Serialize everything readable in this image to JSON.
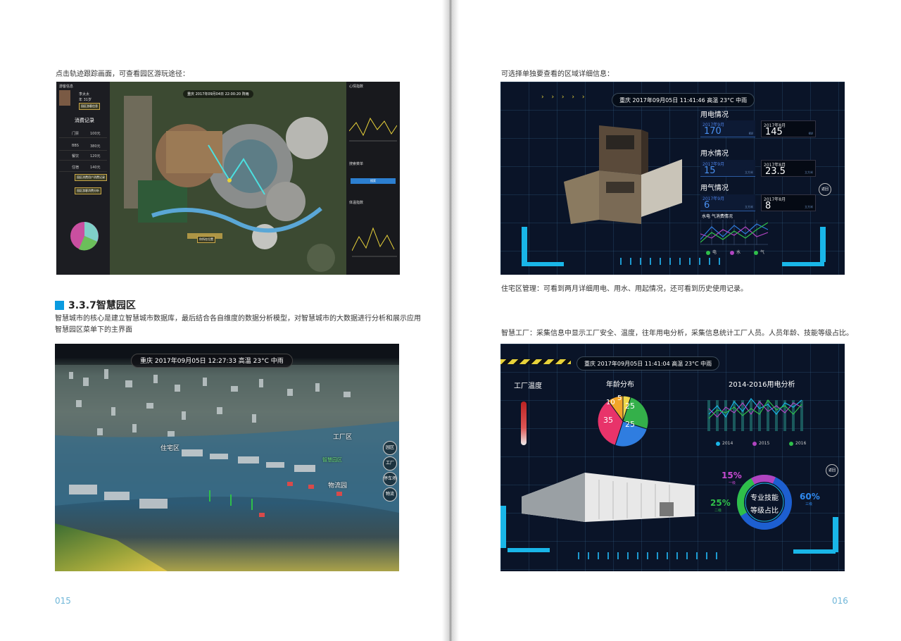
{
  "left_page": {
    "caption_top": "点击轨迹跟踪画面，可查看园区游玩途径：",
    "section": {
      "number_title": "3.3.7智慧园区"
    },
    "body_lines": [
      "智慧城市的核心是建立智慧城市数据库，最后结合各自维度的数据分析模型，对智慧城市的大数据进行分析和展示应用",
      "智慧园区菜单下的主界面"
    ],
    "page_number": "015",
    "tracking_screen": {
      "header_left": "游客信息",
      "visitor_name": "李太太",
      "visitor_age": "年 31岁",
      "tag1": "园区游客信息",
      "consume_title": "消费记录",
      "consume_rows": [
        {
          "label": "门票",
          "value": "100元"
        },
        {
          "label": "BBS",
          "value": "380元"
        },
        {
          "label": "餐饮",
          "value": "120元"
        },
        {
          "label": "住宿",
          "value": "140元"
        }
      ],
      "tag2": "园区消费用户消费记录",
      "tag3": "园区游客消费分析",
      "top_bar": "重庆  2017年09月04日 22:00:20  阵雨",
      "map_marker": "你所在位置",
      "right_panel_title": "心情指数",
      "right_panel_mid": "搜索菜单",
      "right_panel_btn": "搜索",
      "right_panel_bottom": "体温指数"
    },
    "city_screen": {
      "info_bar": "重庆   2017年09月05日 12:27:33   高温 23°C   中雨",
      "labels": {
        "residential": "住宅区",
        "factory": "工厂区",
        "logistics": "物流园",
        "marker": "智慧园区"
      },
      "side_buttons": [
        "园区",
        "工厂",
        "停车场",
        "物流"
      ]
    }
  },
  "right_page": {
    "caption_top": "可选择单独要查看的区域详细信息：",
    "caption_mid": "住宅区管理：可看到两月详细用电、用水、用起情况，还可看到历史使用记录。",
    "caption_factory": "智慧工厂：采集信息中显示工厂安全、温度，往年用电分析，采集信息统计工厂人员。人员年龄、技能等级占比。",
    "page_number": "016",
    "residential_screen": {
      "info_bar": "重庆  2017年09月05日 11:41:46  高温 23°C  中雨",
      "sections": [
        {
          "title": "用电情况",
          "left": {
            "month": "2017年9月",
            "value": "170",
            "unit": "KW"
          },
          "right": {
            "month": "2017年8月",
            "value": "145",
            "unit": "KW"
          }
        },
        {
          "title": "用水情况",
          "left": {
            "month": "2017年9月",
            "value": "15",
            "unit": "立方米"
          },
          "right": {
            "month": "2017年8月",
            "value": "23.5",
            "unit": "立方米"
          }
        },
        {
          "title": "用气情况",
          "left": {
            "month": "2017年9月",
            "value": "6",
            "unit": "立方米"
          },
          "right": {
            "month": "2017年8月",
            "value": "8",
            "unit": "立方米"
          }
        }
      ],
      "chart_title": "水电 气消费情况",
      "legend": [
        "电",
        "水",
        "气"
      ],
      "back_button": "返回",
      "colors": {
        "accent": "#19b6e8",
        "electric": "#2f7de0",
        "water": "#b044c0",
        "gas": "#2fbf4a"
      }
    },
    "factory_screen": {
      "info_bar": "重庆  2017年09月05日 11:41:04  高温 23°C  中雨",
      "temp_title": "工厂温度",
      "age_title": "年龄分布",
      "power_title": "2014-2016用电分析",
      "age_pie": [
        {
          "value": "10",
          "color": "#f2a52a"
        },
        {
          "value": "5",
          "color": "#f0d84a"
        },
        {
          "value": "25",
          "color": "#34b04a"
        },
        {
          "value": "25",
          "color": "#2f7de0"
        },
        {
          "value": "35",
          "color": "#e8336a"
        }
      ],
      "legend": [
        "2014",
        "2015",
        "2016"
      ],
      "skill": {
        "center_line1": "专业技能",
        "center_line2": "等级占比",
        "p1": "15%",
        "p1_sub": "一级",
        "p2": "25%",
        "p2_sub": "二级",
        "p3": "60%",
        "p3_sub": "三级"
      },
      "back_button": "返回"
    }
  }
}
